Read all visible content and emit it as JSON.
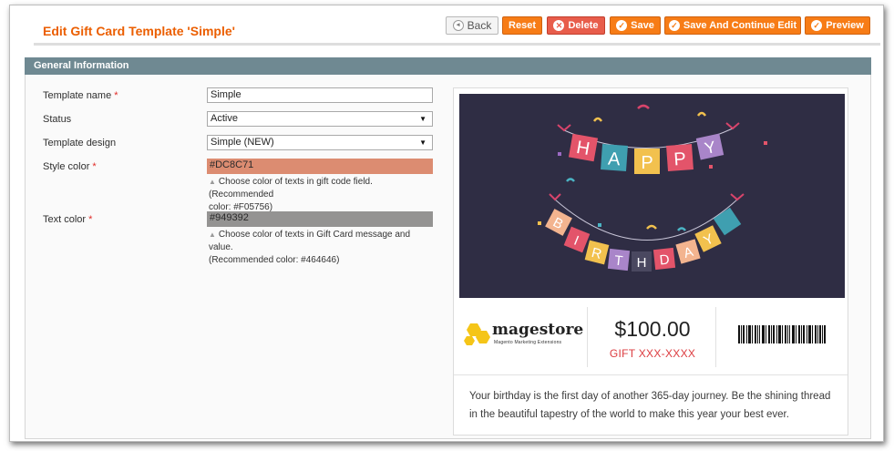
{
  "page": {
    "title": "Edit Gift Card Template 'Simple'"
  },
  "toolbar": {
    "back_label": "Back",
    "reset_label": "Reset",
    "delete_label": "Delete",
    "save_label": "Save",
    "save_continue_label": "Save And Continue Edit",
    "preview_label": "Preview"
  },
  "section": {
    "title": "General Information"
  },
  "form": {
    "template_name": {
      "label": "Template name",
      "required": "*",
      "value": "Simple"
    },
    "status": {
      "label": "Status",
      "value": "Active"
    },
    "template_design": {
      "label": "Template design",
      "value": "Simple (NEW)"
    },
    "style_color": {
      "label": "Style color",
      "required": "*",
      "value": "#DC8C71",
      "note_line1": "Choose color of texts in gift code field. (Recommended",
      "note_line2": "color: #F05756)"
    },
    "text_color": {
      "label": "Text color",
      "required": "*",
      "value": "#949392",
      "note_line1": "Choose color of texts in Gift Card message and value.",
      "note_line2": "(Recommended color: #464646)"
    }
  },
  "preview": {
    "banner_top": [
      "H",
      "A",
      "P",
      "P",
      "Y"
    ],
    "banner_bottom": [
      "B",
      "I",
      "R",
      "T",
      "H",
      "D",
      "A",
      "Y"
    ],
    "logo_text": "magestore",
    "logo_subtext": "Magento Marketing Extensions",
    "value": "$100.00",
    "gift_code": "GIFT XXX-XXXX",
    "message_line1": "Your birthday is the first day of another 365-day journey. Be the shining thread",
    "message_line2": "in the beautiful tapestry of the world to make this year your best ever."
  },
  "colors": {
    "accent": "#f77c16",
    "title": "#eb5e00",
    "delete": "#e85d4b",
    "section_bar": "#6f8992",
    "style_color": "#DC8C71",
    "text_color": "#949392",
    "image_bg": "#2f2d44",
    "gift_code": "#dc3b3f"
  },
  "icons": {
    "back": "circle-arrow-left-icon",
    "reset": "none",
    "delete": "circle-x-icon",
    "save": "check-circle-icon",
    "preview": "check-circle-icon",
    "note": "triangle-up-icon",
    "select": "caret-down-icon"
  }
}
